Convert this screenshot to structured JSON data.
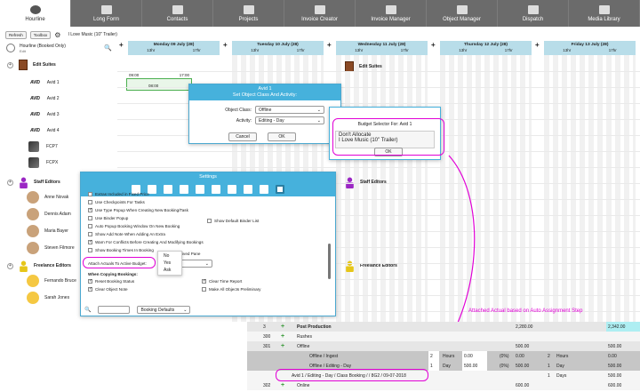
{
  "nav": {
    "items": [
      {
        "label": "Hourline",
        "icon": "clock-icon",
        "active": true
      },
      {
        "label": "Long Form",
        "icon": "film-icon",
        "active": false
      },
      {
        "label": "Contacts",
        "icon": "contacts-icon",
        "active": false
      },
      {
        "label": "Projects",
        "icon": "projects-icon",
        "active": false
      },
      {
        "label": "Invoice Creator",
        "icon": "invoice-icon",
        "active": false
      },
      {
        "label": "Invoice Manager",
        "icon": "invoice-manager-icon",
        "active": false
      },
      {
        "label": "Object Manager",
        "icon": "object-manager-icon",
        "active": false
      },
      {
        "label": "Dispatch",
        "icon": "dispatch-icon",
        "active": false
      },
      {
        "label": "Media Library",
        "icon": "media-library-icon",
        "active": false
      }
    ]
  },
  "toolbar": {
    "refresh": "Refresh",
    "toolbox": "Toolbox",
    "project_title": "I Love Music (10\" Trailer)"
  },
  "left": {
    "hourline_title": "Hourline (Booked Only)",
    "hourline_sub": "Edit",
    "groups": {
      "edit_suites": "Edit Suites",
      "staff_editors": "Staff Editors",
      "freelance_editors": "Freelance Editors"
    },
    "rooms": [
      "Avid 1",
      "Avid 2",
      "Avid 3",
      "Avid 4",
      "FCP7",
      "FCPX"
    ],
    "avid_logo": "AVID",
    "staff": [
      "Anne Novak",
      "Dennis Adam",
      "Maria Bayer",
      "Steven Filmore"
    ],
    "freelance": [
      "Fernando Bruce",
      "Sarah Jones"
    ]
  },
  "calendar": {
    "days": [
      {
        "name": "Monday 09 July (28)",
        "h1": "13hr",
        "h2": "17hr"
      },
      {
        "name": "Tuesday 10 July (28)",
        "h1": "13hr",
        "h2": "17hr"
      },
      {
        "name": "Wednesday 11 July (28)",
        "h1": "13hr",
        "h2": "17hr"
      },
      {
        "name": "Thursday 12 July (28)",
        "h1": "13hr",
        "h2": "17hr"
      },
      {
        "name": "Friday 13 July (28)",
        "h1": "13hr",
        "h2": "17hr"
      }
    ],
    "booking": {
      "start": "09:00",
      "end": "17:00",
      "mid": "08:00"
    },
    "right_groups": {
      "edit_suites": "Edit Suites",
      "staff_editors": "Staff Editors",
      "freelance_editors": "Freelance Editors"
    }
  },
  "avid_dialog": {
    "title_line1": "Avid 1",
    "title_line2": "Set Object Class And Activity:",
    "class_label": "Object Class:",
    "class_value": "Offline",
    "activity_label": "Activity:",
    "activity_value": "Editing - Day",
    "cancel": "Cancel",
    "ok": "OK"
  },
  "budget_dialog": {
    "title": "Budget Selector For: Avid 1",
    "options": [
      "Don't Allocate",
      "I Love Music (10\" Trailer)"
    ],
    "ok": "OK"
  },
  "settings": {
    "title": "Settings",
    "rows": [
      {
        "label": "Extras Included in Fixed Price",
        "checked": false
      },
      {
        "label": "Use Checkpoints For Tasks",
        "checked": false
      },
      {
        "label": "Use Type Popup When Creating New Booking/Task",
        "checked": true
      },
      {
        "label": "Use Binder Popup",
        "checked": false
      },
      {
        "label": "Auto Popup Booking Window On New Booking",
        "checked": false
      },
      {
        "label": "Show Add Note When Adding An Extra",
        "checked": false
      },
      {
        "label": "Warn For Conflicts Before Creating And Modifying Bookings",
        "checked": true
      },
      {
        "label": "Show Booking Times In Booking",
        "checked": false
      }
    ],
    "show_default_binder": "Show Default Binder List",
    "lived_pane": "ived Pane",
    "attach_label": "Attach Actuals To Active Budget:",
    "attach_options": [
      "No",
      "Yes",
      "Ask"
    ],
    "copying_header": "When Copying Bookings:",
    "copy_rows": [
      {
        "label": "Reset Booking Status",
        "checked": true
      },
      {
        "label": "Clear Object Note",
        "checked": true
      }
    ],
    "copy_rows_right": [
      {
        "label": "Clear Time Report",
        "checked": true
      },
      {
        "label": "Make All Objects Preliminary",
        "checked": false
      }
    ],
    "search_placeholder": "",
    "defaults_value": "Booking Defaults"
  },
  "annotation": "Attached Actual based on Auto Assignment Step",
  "table": {
    "rows": [
      {
        "num": "3",
        "label": "Post Production",
        "v1": "2,280.00",
        "v2": "2,342.00"
      },
      {
        "num": "300",
        "label": "Rushes",
        "v1": "",
        "v2": ""
      },
      {
        "num": "301",
        "label": "Offline",
        "v1": "500.00",
        "v2": "500.00"
      },
      {
        "num": "",
        "label": "Offline / Ingest",
        "qty": "2",
        "unit": "Hours",
        "price": "0.00",
        "pct": "(0%)",
        "amt": "0.00",
        "q2": "2",
        "u2": "Hours",
        "a2": "0.00"
      },
      {
        "num": "",
        "label": "Offline / Editing - Day",
        "qty": "1",
        "unit": "Day",
        "price": "500.00",
        "pct": "(0%)",
        "amt": "500.00",
        "q2": "1",
        "u2": "Day",
        "a2": "500.00"
      },
      {
        "num": "",
        "label": "Avid 1 / Editing - Day / Class Booking / / 8G2 / 09-07-2018",
        "q2": "1",
        "u2": "Days",
        "a2": "500.00"
      },
      {
        "num": "302",
        "label": "Online",
        "v1": "600.00",
        "v2": "600.00"
      }
    ]
  }
}
